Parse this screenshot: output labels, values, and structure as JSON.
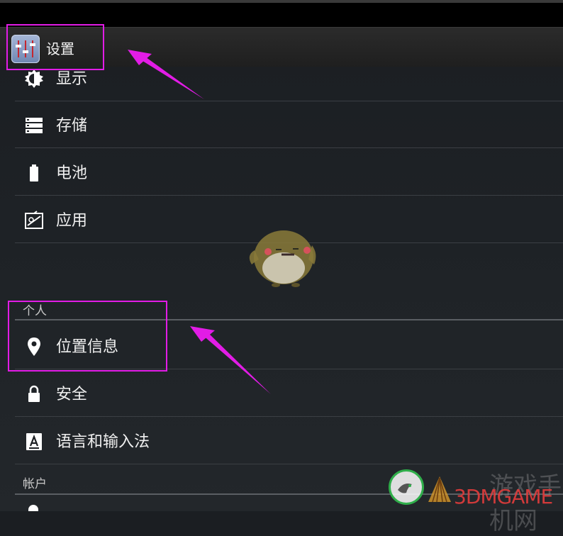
{
  "app": {
    "title": "设置",
    "icon": "equalizer-settings-icon"
  },
  "device_items": [
    {
      "label": "显示",
      "icon": "brightness-icon"
    },
    {
      "label": "存储",
      "icon": "storage-icon"
    },
    {
      "label": "电池",
      "icon": "battery-icon"
    },
    {
      "label": "应用",
      "icon": "apps-icon"
    }
  ],
  "sections": {
    "personal": "个人",
    "accounts": "帐户"
  },
  "personal_items": [
    {
      "label": "位置信息",
      "icon": "location-pin-icon"
    },
    {
      "label": "安全",
      "icon": "lock-icon"
    },
    {
      "label": "语言和输入法",
      "icon": "keyboard-a-icon"
    }
  ],
  "annotations": {
    "highlight_color": "#e21ce6"
  },
  "watermark": {
    "text": "3DMGAME",
    "faint_text": "游戏手机网"
  }
}
